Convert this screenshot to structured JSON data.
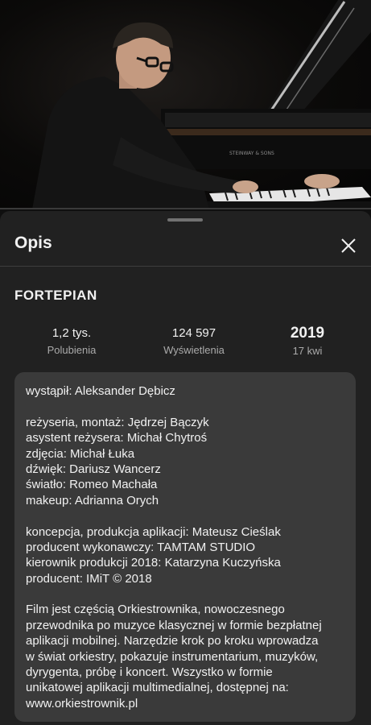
{
  "video": {
    "progress_percent": 0
  },
  "sheet": {
    "title": "Opis",
    "close_icon": "close-icon"
  },
  "video_title": "FORTEPIAN",
  "stats": {
    "likes": {
      "value": "1,2 tys.",
      "label": "Polubienia"
    },
    "views": {
      "value": "124 597",
      "label": "Wyświetlenia"
    },
    "date": {
      "year": "2019",
      "day": "17 kwi"
    }
  },
  "description": {
    "lines": [
      "wystąpił: Aleksander Dębicz",
      "",
      "reżyseria, montaż: Jędrzej Bączyk",
      "asystent reżysera: Michał Chytroś",
      "zdjęcia: Michał Łuka",
      "dźwięk: Dariusz Wancerz",
      "światło: Romeo Machała",
      "makeup: Adrianna Orych",
      "",
      "koncepcja, produkcja aplikacji: Mateusz Cieślak",
      "producent wykonawczy: TAMTAM STUDIO",
      "kierownik produkcji 2018: Katarzyna Kuczyńska",
      "producent: IMiT © 2018",
      "",
      "Film jest częścią Orkiestrownika, nowoczesnego",
      "przewodnika po muzyce klasycznej w formie bezpłatnej",
      "aplikacji mobilnej. Narzędzie krok po kroku wprowadza",
      "w świat orkiestry, pokazuje instrumentarium, muzyków,",
      "dyrygenta, próbę i koncert. Wszystko w formie",
      "unikatowej aplikacji multimedialnej, dostępnej na:",
      "www.orkiestrownik.pl"
    ]
  }
}
